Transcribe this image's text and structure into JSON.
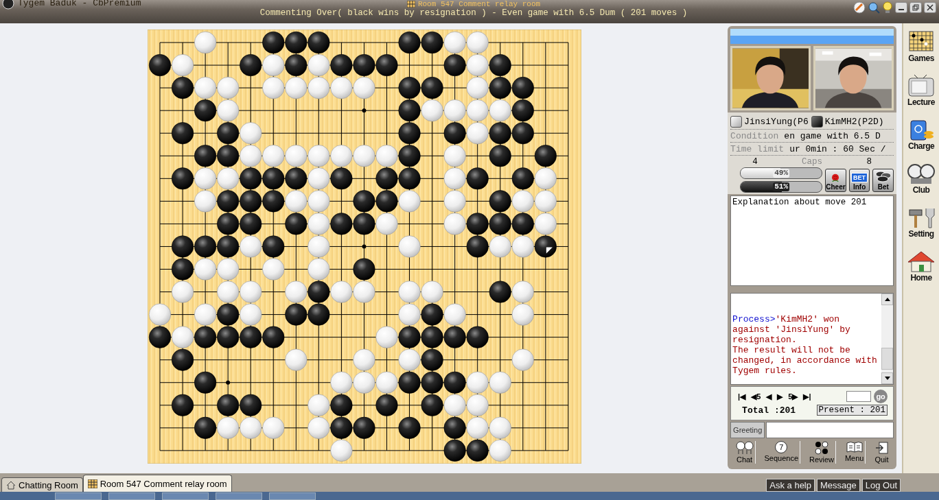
{
  "window": {
    "title": "Tygem Baduk - CbPremium",
    "room_title": "Room 547 Comment relay room",
    "subtitle": "Commenting Over( black wins by resignation ) - Even game with 6.5 Dum  ( 201 moves )"
  },
  "board": {
    "rows": [
      [
        {
          "kind": "empty"
        },
        {
          "kind": "empty"
        },
        {
          "kind": "white"
        },
        {
          "kind": "empty"
        },
        {
          "kind": "empty"
        },
        {
          "kind": "black"
        },
        {
          "kind": "black"
        },
        {
          "kind": "black"
        },
        {
          "kind": "empty"
        },
        {
          "kind": "empty"
        },
        {
          "kind": "empty"
        },
        {
          "kind": "black"
        },
        {
          "kind": "black"
        },
        {
          "kind": "white"
        },
        {
          "kind": "white"
        },
        {
          "kind": "empty"
        },
        {
          "kind": "empty"
        },
        {
          "kind": "empty"
        },
        {
          "kind": "empty"
        }
      ],
      [
        {
          "kind": "black"
        },
        {
          "kind": "white"
        },
        {
          "kind": "empty"
        },
        {
          "kind": "empty"
        },
        {
          "kind": "black"
        },
        {
          "kind": "white"
        },
        {
          "kind": "black"
        },
        {
          "kind": "white"
        },
        {
          "kind": "black"
        },
        {
          "kind": "black"
        },
        {
          "kind": "black"
        },
        {
          "kind": "empty"
        },
        {
          "kind": "empty"
        },
        {
          "kind": "black"
        },
        {
          "kind": "white"
        },
        {
          "kind": "black"
        },
        {
          "kind": "empty"
        },
        {
          "kind": "empty"
        },
        {
          "kind": "empty"
        }
      ],
      [
        {
          "kind": "empty"
        },
        {
          "kind": "black"
        },
        {
          "kind": "white"
        },
        {
          "kind": "white"
        },
        {
          "kind": "empty"
        },
        {
          "kind": "white"
        },
        {
          "kind": "white"
        },
        {
          "kind": "white"
        },
        {
          "kind": "white"
        },
        {
          "kind": "white"
        },
        {
          "kind": "empty"
        },
        {
          "kind": "black"
        },
        {
          "kind": "black"
        },
        {
          "kind": "empty"
        },
        {
          "kind": "white"
        },
        {
          "kind": "black"
        },
        {
          "kind": "black"
        },
        {
          "kind": "empty"
        },
        {
          "kind": "empty"
        }
      ],
      [
        {
          "kind": "empty"
        },
        {
          "kind": "empty"
        },
        {
          "kind": "black"
        },
        {
          "kind": "white"
        },
        {
          "kind": "empty"
        },
        {
          "kind": "empty"
        },
        {
          "kind": "empty"
        },
        {
          "kind": "empty"
        },
        {
          "kind": "empty"
        },
        {
          "kind": "empty"
        },
        {
          "kind": "empty"
        },
        {
          "kind": "black"
        },
        {
          "kind": "white"
        },
        {
          "kind": "white"
        },
        {
          "kind": "white"
        },
        {
          "kind": "white"
        },
        {
          "kind": "black"
        },
        {
          "kind": "empty"
        },
        {
          "kind": "empty"
        }
      ],
      [
        {
          "kind": "empty"
        },
        {
          "kind": "black"
        },
        {
          "kind": "empty"
        },
        {
          "kind": "black"
        },
        {
          "kind": "white"
        },
        {
          "kind": "empty"
        },
        {
          "kind": "empty"
        },
        {
          "kind": "empty"
        },
        {
          "kind": "empty"
        },
        {
          "kind": "empty"
        },
        {
          "kind": "empty"
        },
        {
          "kind": "black"
        },
        {
          "kind": "empty"
        },
        {
          "kind": "black"
        },
        {
          "kind": "white"
        },
        {
          "kind": "black"
        },
        {
          "kind": "black"
        },
        {
          "kind": "empty"
        },
        {
          "kind": "empty"
        }
      ],
      [
        {
          "kind": "empty"
        },
        {
          "kind": "empty"
        },
        {
          "kind": "black"
        },
        {
          "kind": "black"
        },
        {
          "kind": "white"
        },
        {
          "kind": "white"
        },
        {
          "kind": "white"
        },
        {
          "kind": "white"
        },
        {
          "kind": "white"
        },
        {
          "kind": "white"
        },
        {
          "kind": "white"
        },
        {
          "kind": "black"
        },
        {
          "kind": "empty"
        },
        {
          "kind": "white"
        },
        {
          "kind": "empty"
        },
        {
          "kind": "black"
        },
        {
          "kind": "empty"
        },
        {
          "kind": "black"
        },
        {
          "kind": "empty"
        }
      ],
      [
        {
          "kind": "empty"
        },
        {
          "kind": "black"
        },
        {
          "kind": "white"
        },
        {
          "kind": "white"
        },
        {
          "kind": "black"
        },
        {
          "kind": "black"
        },
        {
          "kind": "black"
        },
        {
          "kind": "white"
        },
        {
          "kind": "black"
        },
        {
          "kind": "empty"
        },
        {
          "kind": "black"
        },
        {
          "kind": "black"
        },
        {
          "kind": "empty"
        },
        {
          "kind": "white"
        },
        {
          "kind": "black"
        },
        {
          "kind": "empty"
        },
        {
          "kind": "black"
        },
        {
          "kind": "white"
        },
        {
          "kind": "empty"
        }
      ],
      [
        {
          "kind": "empty"
        },
        {
          "kind": "empty"
        },
        {
          "kind": "white"
        },
        {
          "kind": "black"
        },
        {
          "kind": "black"
        },
        {
          "kind": "black"
        },
        {
          "kind": "white"
        },
        {
          "kind": "white"
        },
        {
          "kind": "empty"
        },
        {
          "kind": "black"
        },
        {
          "kind": "black"
        },
        {
          "kind": "white"
        },
        {
          "kind": "empty"
        },
        {
          "kind": "white"
        },
        {
          "kind": "empty"
        },
        {
          "kind": "black"
        },
        {
          "kind": "white"
        },
        {
          "kind": "white"
        },
        {
          "kind": "empty"
        }
      ],
      [
        {
          "kind": "empty"
        },
        {
          "kind": "empty"
        },
        {
          "kind": "empty"
        },
        {
          "kind": "black"
        },
        {
          "kind": "black"
        },
        {
          "kind": "empty"
        },
        {
          "kind": "black"
        },
        {
          "kind": "white"
        },
        {
          "kind": "black"
        },
        {
          "kind": "black"
        },
        {
          "kind": "white"
        },
        {
          "kind": "empty"
        },
        {
          "kind": "empty"
        },
        {
          "kind": "white"
        },
        {
          "kind": "black"
        },
        {
          "kind": "black"
        },
        {
          "kind": "black"
        },
        {
          "kind": "white"
        },
        {
          "kind": "empty"
        }
      ],
      [
        {
          "kind": "empty"
        },
        {
          "kind": "black"
        },
        {
          "kind": "black"
        },
        {
          "kind": "black"
        },
        {
          "kind": "white"
        },
        {
          "kind": "black"
        },
        {
          "kind": "empty"
        },
        {
          "kind": "white"
        },
        {
          "kind": "empty"
        },
        {
          "kind": "empty"
        },
        {
          "kind": "empty"
        },
        {
          "kind": "white"
        },
        {
          "kind": "empty"
        },
        {
          "kind": "empty"
        },
        {
          "kind": "black"
        },
        {
          "kind": "white"
        },
        {
          "kind": "white"
        },
        {
          "kind": "black_last"
        },
        {
          "kind": "empty"
        }
      ],
      [
        {
          "kind": "empty"
        },
        {
          "kind": "black"
        },
        {
          "kind": "white"
        },
        {
          "kind": "white"
        },
        {
          "kind": "empty"
        },
        {
          "kind": "white"
        },
        {
          "kind": "empty"
        },
        {
          "kind": "white"
        },
        {
          "kind": "empty"
        },
        {
          "kind": "black"
        },
        {
          "kind": "empty"
        },
        {
          "kind": "empty"
        },
        {
          "kind": "empty"
        },
        {
          "kind": "empty"
        },
        {
          "kind": "empty"
        },
        {
          "kind": "empty"
        },
        {
          "kind": "empty"
        },
        {
          "kind": "empty"
        },
        {
          "kind": "empty"
        }
      ],
      [
        {
          "kind": "empty"
        },
        {
          "kind": "white"
        },
        {
          "kind": "empty"
        },
        {
          "kind": "white"
        },
        {
          "kind": "white"
        },
        {
          "kind": "empty"
        },
        {
          "kind": "white"
        },
        {
          "kind": "black"
        },
        {
          "kind": "white"
        },
        {
          "kind": "white"
        },
        {
          "kind": "empty"
        },
        {
          "kind": "white"
        },
        {
          "kind": "white"
        },
        {
          "kind": "empty"
        },
        {
          "kind": "empty"
        },
        {
          "kind": "black"
        },
        {
          "kind": "white"
        },
        {
          "kind": "empty"
        },
        {
          "kind": "empty"
        }
      ],
      [
        {
          "kind": "white"
        },
        {
          "kind": "empty"
        },
        {
          "kind": "white"
        },
        {
          "kind": "black"
        },
        {
          "kind": "white"
        },
        {
          "kind": "empty"
        },
        {
          "kind": "black"
        },
        {
          "kind": "black"
        },
        {
          "kind": "empty"
        },
        {
          "kind": "empty"
        },
        {
          "kind": "empty"
        },
        {
          "kind": "white"
        },
        {
          "kind": "black"
        },
        {
          "kind": "white"
        },
        {
          "kind": "empty"
        },
        {
          "kind": "empty"
        },
        {
          "kind": "white"
        },
        {
          "kind": "empty"
        },
        {
          "kind": "empty"
        }
      ],
      [
        {
          "kind": "black"
        },
        {
          "kind": "white"
        },
        {
          "kind": "black"
        },
        {
          "kind": "black"
        },
        {
          "kind": "black"
        },
        {
          "kind": "black"
        },
        {
          "kind": "empty"
        },
        {
          "kind": "empty"
        },
        {
          "kind": "empty"
        },
        {
          "kind": "empty"
        },
        {
          "kind": "white"
        },
        {
          "kind": "black"
        },
        {
          "kind": "black"
        },
        {
          "kind": "black"
        },
        {
          "kind": "black"
        },
        {
          "kind": "empty"
        },
        {
          "kind": "empty"
        },
        {
          "kind": "empty"
        },
        {
          "kind": "empty"
        }
      ],
      [
        {
          "kind": "empty"
        },
        {
          "kind": "black"
        },
        {
          "kind": "empty"
        },
        {
          "kind": "empty"
        },
        {
          "kind": "empty"
        },
        {
          "kind": "empty"
        },
        {
          "kind": "white"
        },
        {
          "kind": "empty"
        },
        {
          "kind": "empty"
        },
        {
          "kind": "white"
        },
        {
          "kind": "empty"
        },
        {
          "kind": "white"
        },
        {
          "kind": "black"
        },
        {
          "kind": "empty"
        },
        {
          "kind": "empty"
        },
        {
          "kind": "empty"
        },
        {
          "kind": "white"
        },
        {
          "kind": "empty"
        },
        {
          "kind": "empty"
        }
      ],
      [
        {
          "kind": "empty"
        },
        {
          "kind": "empty"
        },
        {
          "kind": "black"
        },
        {
          "kind": "empty"
        },
        {
          "kind": "empty"
        },
        {
          "kind": "empty"
        },
        {
          "kind": "empty"
        },
        {
          "kind": "empty"
        },
        {
          "kind": "white"
        },
        {
          "kind": "white"
        },
        {
          "kind": "white"
        },
        {
          "kind": "black"
        },
        {
          "kind": "black"
        },
        {
          "kind": "black"
        },
        {
          "kind": "white"
        },
        {
          "kind": "white"
        },
        {
          "kind": "empty"
        },
        {
          "kind": "empty"
        },
        {
          "kind": "empty"
        }
      ],
      [
        {
          "kind": "empty"
        },
        {
          "kind": "black"
        },
        {
          "kind": "empty"
        },
        {
          "kind": "black"
        },
        {
          "kind": "black"
        },
        {
          "kind": "empty"
        },
        {
          "kind": "empty"
        },
        {
          "kind": "white"
        },
        {
          "kind": "black"
        },
        {
          "kind": "empty"
        },
        {
          "kind": "black"
        },
        {
          "kind": "empty"
        },
        {
          "kind": "black"
        },
        {
          "kind": "white"
        },
        {
          "kind": "white"
        },
        {
          "kind": "empty"
        },
        {
          "kind": "empty"
        },
        {
          "kind": "empty"
        },
        {
          "kind": "empty"
        }
      ],
      [
        {
          "kind": "empty"
        },
        {
          "kind": "empty"
        },
        {
          "kind": "black"
        },
        {
          "kind": "white"
        },
        {
          "kind": "white"
        },
        {
          "kind": "white"
        },
        {
          "kind": "empty"
        },
        {
          "kind": "white"
        },
        {
          "kind": "black"
        },
        {
          "kind": "black"
        },
        {
          "kind": "empty"
        },
        {
          "kind": "black"
        },
        {
          "kind": "empty"
        },
        {
          "kind": "black"
        },
        {
          "kind": "white"
        },
        {
          "kind": "white"
        },
        {
          "kind": "empty"
        },
        {
          "kind": "empty"
        },
        {
          "kind": "empty"
        }
      ],
      [
        {
          "kind": "empty"
        },
        {
          "kind": "empty"
        },
        {
          "kind": "empty"
        },
        {
          "kind": "empty"
        },
        {
          "kind": "empty"
        },
        {
          "kind": "empty"
        },
        {
          "kind": "empty"
        },
        {
          "kind": "empty"
        },
        {
          "kind": "white"
        },
        {
          "kind": "empty"
        },
        {
          "kind": "empty"
        },
        {
          "kind": "empty"
        },
        {
          "kind": "empty"
        },
        {
          "kind": "black"
        },
        {
          "kind": "black"
        },
        {
          "kind": "white"
        },
        {
          "kind": "empty"
        },
        {
          "kind": "empty"
        },
        {
          "kind": "empty"
        }
      ]
    ]
  },
  "players": [
    {
      "name": "JinsiYung(P6",
      "kind": "white",
      "caps": "4"
    },
    {
      "name": "KimMH2(P2D)",
      "kind": "black",
      "caps": "8"
    }
  ],
  "condition": {
    "label": "Condition",
    "value": "en game with 6.5 D"
  },
  "time_limit": {
    "label": "Time limit",
    "value": "ur 0min : 60 Sec /"
  },
  "caps_label": "Caps",
  "win_rates": [
    {
      "kind": "white",
      "level": 0.49,
      "reading": "49%"
    },
    {
      "kind": "black",
      "level": 0.51,
      "reading": "51%"
    }
  ],
  "actions": [
    {
      "kind": "cheer",
      "label": "Cheer"
    },
    {
      "kind": "info",
      "label": "Info",
      "badge": "BET"
    },
    {
      "kind": "bet",
      "label": "Bet"
    }
  ],
  "explanation": "Explanation about move 201",
  "chat": [
    {
      "kind": "system",
      "prefix": "Process>",
      "text": "'KimMH2' won against 'JinsiYung' by resignation."
    },
    {
      "kind": "notice",
      "text": "The result will not be changed, in accordance with Tygem rules."
    }
  ],
  "navigation": {
    "buttons": [
      "|◀",
      "◀5",
      "◀",
      "▶",
      "5▶",
      "▶|"
    ],
    "go": "go",
    "total": "Total :201",
    "present": "Present : 201"
  },
  "greeting": {
    "label": "Greeting"
  },
  "tools": [
    {
      "kind": "chat",
      "label": "Chat"
    },
    {
      "kind": "sequence",
      "label": "Sequence",
      "glyph": "7"
    },
    {
      "kind": "review",
      "label": "Review"
    },
    {
      "kind": "menu",
      "label": "Menu"
    },
    {
      "kind": "quit",
      "label": "Quit"
    }
  ],
  "sidebar": [
    {
      "kind": "games",
      "label": "Games"
    },
    {
      "kind": "lecture",
      "label": "Lecture"
    },
    {
      "kind": "charge",
      "label": "Charge"
    },
    {
      "kind": "club",
      "label": "Club"
    },
    {
      "kind": "setting",
      "label": "Setting"
    },
    {
      "kind": "home",
      "label": "Home"
    }
  ],
  "tabs": [
    {
      "label": "Chatting Room",
      "kind": "home",
      "selected": false
    },
    {
      "label": "Room 547 Comment relay room",
      "kind": "board",
      "selected": true
    }
  ],
  "footer_buttons": [
    "Ask a help",
    "Message",
    "Log Out"
  ]
}
